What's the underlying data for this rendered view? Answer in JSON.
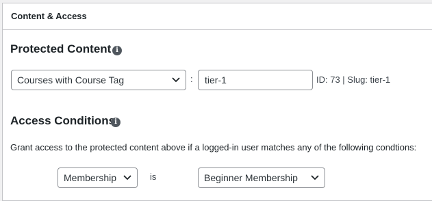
{
  "panel": {
    "title": "Content & Access"
  },
  "protected_content": {
    "heading": "Protected Content",
    "content_type_select": {
      "selected": "Courses with Course Tag"
    },
    "separator": ":",
    "tag_input": {
      "value": "tier-1"
    },
    "id_slug_text": "ID: 73 | Slug: tier-1"
  },
  "access_conditions": {
    "heading": "Access Conditions",
    "description": "Grant access to the protected content above if a logged-in user matches any of the following condtions:",
    "condition": {
      "type_select": {
        "selected": "Membership"
      },
      "operator": "is",
      "value_select": {
        "selected": "Beginner Membership"
      }
    }
  },
  "icons": {
    "info": "info-icon",
    "chevron": "chevron-down-icon"
  },
  "colors": {
    "border": "#8c8f94",
    "text": "#1d2327",
    "icon": "#50575e"
  }
}
